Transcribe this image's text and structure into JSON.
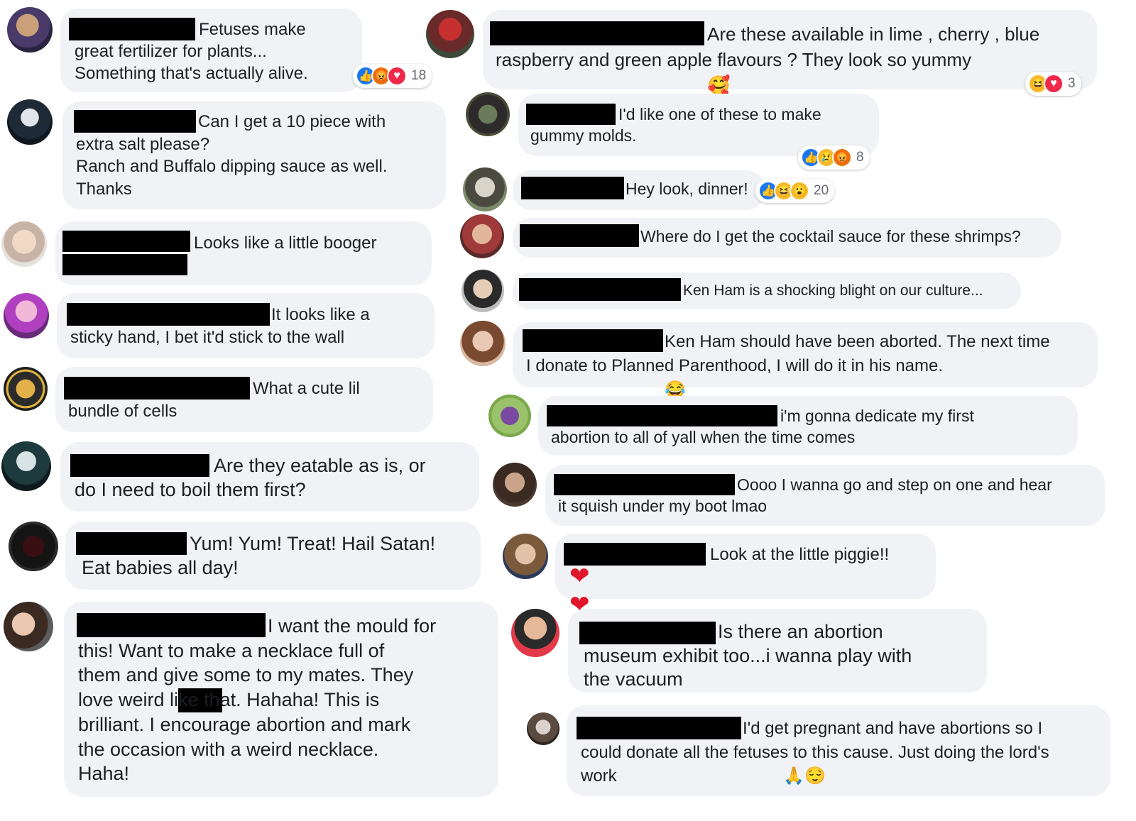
{
  "colors": {
    "bubble": "#f0f2f5",
    "text": "#1c1e21",
    "like": "#1877f2",
    "love": "#f02849",
    "angry": "#e9710f",
    "haha": "#f7b928",
    "redaction": "#000000"
  },
  "comments": [
    {
      "text": "Fetuses make\ngreat fertilizer for plants...\nSomething that's actually alive.",
      "reactions": [
        "like-icon",
        "angry-icon",
        "love-icon"
      ],
      "count": "18"
    },
    {
      "text": "Can I get a 10 piece with\nextra salt please?\nRanch and Buffalo dipping sauce as well.\nThanks"
    },
    {
      "text": "Looks like a little booger"
    },
    {
      "text": "It looks like a\nsticky hand, I bet it'd stick to the wall"
    },
    {
      "text": "What a cute lil\nbundle of cells"
    },
    {
      "text": "Are they eatable as is, or\ndo I need to boil them first?"
    },
    {
      "text": "Yum! Yum! Treat! Hail Satan!\nEat babies all day!"
    },
    {
      "text": "I want the mould for\nthis! Want to make a necklace full of\nthem and give some to my mates. They\nlove weird        like that. Hahaha! This is\nbrilliant. I encourage abortion and mark\nthe occasion with a weird necklace.\nHaha!"
    },
    {
      "text": "Are these available in lime , cherry , blue\nraspberry and green apple flavours ? They look so yummy",
      "emoji": "🥰",
      "reactions": [
        "haha-icon",
        "love-icon"
      ],
      "count": "3"
    },
    {
      "text": "I'd like one of these to make\ngummy molds.",
      "reactions": [
        "like-icon",
        "sad-icon",
        "angry-icon"
      ],
      "count": "8"
    },
    {
      "text": "Hey look, dinner!",
      "reactions": [
        "like-icon",
        "haha-icon",
        "wow-icon"
      ],
      "count": "20"
    },
    {
      "text": "Where do I get the cocktail sauce for these shrimps?"
    },
    {
      "text": "Ken Ham is a shocking blight on our culture..."
    },
    {
      "text": "Ken Ham should have been aborted. The next time\nI donate to Planned Parenthood, I will do it in his name.",
      "emoji": "😂"
    },
    {
      "text": "i'm gonna dedicate my first\nabortion to all of yall when the time comes"
    },
    {
      "text": "Oooo I wanna go and step on one and hear\nit squish under my boot lmao"
    },
    {
      "text": "Look at the little piggie!!",
      "emoji": "❤❤❤"
    },
    {
      "text": "Is there an abortion\nmuseum exhibit too...i wanna play with\nthe vacuum"
    },
    {
      "text": "I'd get pregnant and have abortions so I\ncould donate all the fetuses to this cause. Just doing the lord's\nwork",
      "emoji": "🙏😌"
    }
  ]
}
